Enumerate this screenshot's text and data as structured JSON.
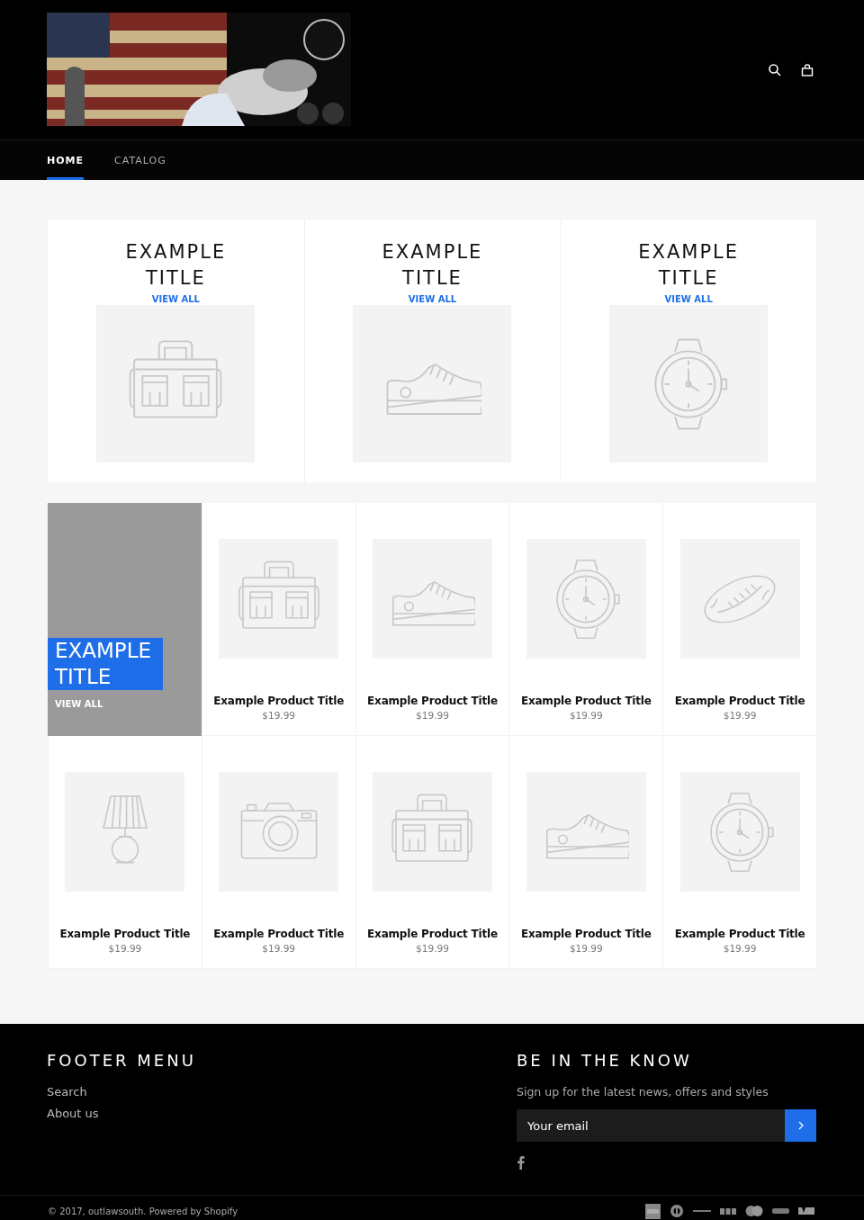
{
  "header": {
    "nav": [
      {
        "label": "HOME",
        "selected": true
      },
      {
        "label": "CATALOG",
        "selected": false
      }
    ]
  },
  "collections": [
    {
      "title": "EXAMPLE TITLE",
      "link": "VIEW ALL",
      "kind": "bag"
    },
    {
      "title": "EXAMPLE TITLE",
      "link": "VIEW ALL",
      "kind": "shoe"
    },
    {
      "title": "EXAMPLE TITLE",
      "link": "VIEW ALL",
      "kind": "watch"
    }
  ],
  "featured": {
    "title": "EXAMPLE TITLE",
    "link": "VIEW ALL",
    "products": [
      {
        "title": "Example Product Title",
        "price": "$19.99",
        "kind": "bag"
      },
      {
        "title": "Example Product Title",
        "price": "$19.99",
        "kind": "shoe"
      },
      {
        "title": "Example Product Title",
        "price": "$19.99",
        "kind": "watch"
      },
      {
        "title": "Example Product Title",
        "price": "$19.99",
        "kind": "football"
      },
      {
        "title": "Example Product Title",
        "price": "$19.99",
        "kind": "lamp"
      },
      {
        "title": "Example Product Title",
        "price": "$19.99",
        "kind": "camera"
      },
      {
        "title": "Example Product Title",
        "price": "$19.99",
        "kind": "bag"
      },
      {
        "title": "Example Product Title",
        "price": "$19.99",
        "kind": "shoe"
      },
      {
        "title": "Example Product Title",
        "price": "$19.99",
        "kind": "watch"
      }
    ]
  },
  "footer": {
    "menu_title": "FOOTER MENU",
    "menu": [
      "Search",
      "About us"
    ],
    "newsletter_title": "BE IN THE KNOW",
    "newsletter_text": "Sign up for the latest news, offers and styles",
    "email_placeholder": "Your email",
    "copyright": "© 2017, outlawsouth. Powered by Shopify"
  }
}
